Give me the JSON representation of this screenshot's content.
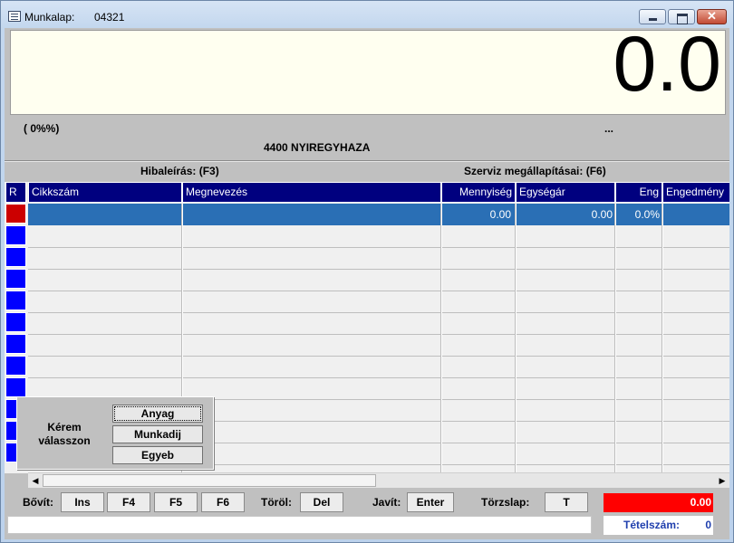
{
  "window": {
    "title": "Munkalap:",
    "id": "04321"
  },
  "display": {
    "value": "0.0"
  },
  "info": {
    "percent": "( 0%%)",
    "dots": "...",
    "city": "4400 NYIREGYHAZA"
  },
  "labels": {
    "hiba": "Hibaleírás:  (F3)",
    "szerviz": "Szerviz megállapításai:  (F6)"
  },
  "table": {
    "columns": [
      "R",
      "Cikkszám",
      "Megnevezés",
      "Mennyiség",
      "Egységár",
      "Eng",
      "Engedmény"
    ],
    "selected_row": {
      "mennyiseg": "0.00",
      "egysegar": "0.00",
      "eng": "0.0%"
    }
  },
  "popup": {
    "message": "Kérem válasszon",
    "buttons": [
      "Anyag",
      "Munkadij",
      "Egyeb"
    ]
  },
  "bottom": {
    "bovit_label": "Bővít:",
    "ins": "Ins",
    "f4": "F4",
    "f5": "F5",
    "f6": "F6",
    "torol_label": "Töröl:",
    "del": "Del",
    "javit_label": "Javít:",
    "enter": "Enter",
    "torzslap_label": "Törzslap:",
    "t": "T",
    "total": "0.00",
    "count_label": "Tételszám:",
    "count_value": "0"
  },
  "colors": {
    "header": "#00007f",
    "selected_row": "#2a6fb5",
    "total_bg": "#ff0000",
    "display_bg": "#fffff0"
  }
}
